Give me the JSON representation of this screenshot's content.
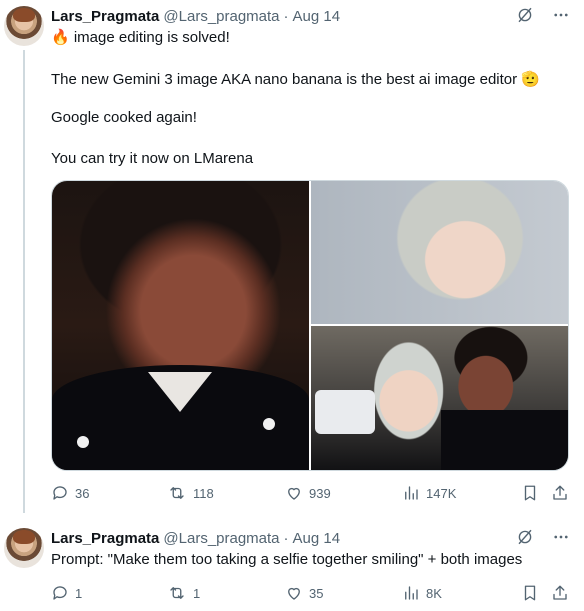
{
  "colors": {
    "text": "#0f1419",
    "secondary": "#536471",
    "border": "#cfd9de"
  },
  "tweets": [
    {
      "name": "Lars_Pragmata",
      "handle": "@Lars_pragmata",
      "separator": "·",
      "date": "Aug 14",
      "lines": [
        "🔥 image editing is solved!",
        "The new Gemini 3 image AKA nano banana is the best ai image editor 🫡",
        "Google cooked again!",
        "You can try it now on LMarena"
      ],
      "stats": {
        "replies": "36",
        "reposts": "118",
        "likes": "939",
        "views": "147K"
      }
    },
    {
      "name": "Lars_Pragmata",
      "handle": "@Lars_pragmata",
      "separator": "·",
      "date": "Aug 14",
      "lines": [
        "Prompt: \"Make them too taking a selfie together smiling\" + both images"
      ],
      "stats": {
        "replies": "1",
        "reposts": "1",
        "likes": "35",
        "views": "8K"
      }
    }
  ],
  "icons": [
    "grok-icon",
    "more-icon",
    "reply-icon",
    "repost-icon",
    "like-icon",
    "views-icon",
    "bookmark-icon",
    "share-icon"
  ]
}
